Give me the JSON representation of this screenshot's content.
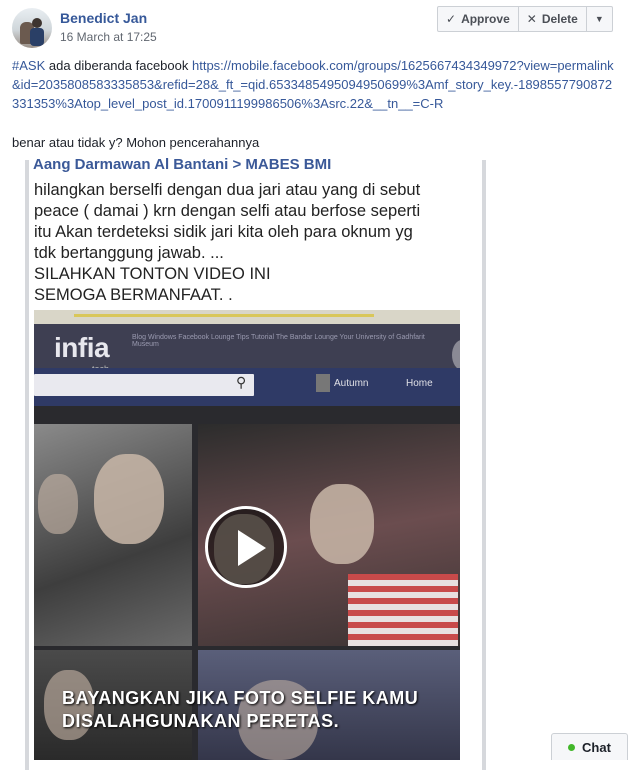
{
  "post": {
    "author": "Benedict Jan",
    "time": "16 March at 17:25",
    "hashtag": "#ASK",
    "text_before_link": " ada diberanda facebook ",
    "link": "https://mobile.facebook.com/groups/1625667434349972?view=permalink&id=2035808583335853&refid=28&_ft_=qid.6533485495094950699%3Amf_story_key.-1898557790872331353%3Atop_level_post_id.1700911199986506%3Asrc.22&__tn__=C-R",
    "question": "benar atau tidak y? Mohon pencerahannya"
  },
  "actions": {
    "approve_label": "Approve",
    "delete_label": "Delete",
    "approve_icon": "check-icon",
    "delete_icon": "close-icon",
    "more_icon": "caret-down-icon"
  },
  "shared": {
    "header": "Aang Darmawan Al Bantani > MABES BMI",
    "body_lines": [
      "hilangkan berselfi dengan dua jari atau yang di sebut",
      "peace ( damai ) krn dengan selfi atau berfose seperti",
      "itu Akan terdeteksi sidik jari kita oleh para oknum yg",
      "tdk bertanggung jawab. ...",
      "SILAHKAN TONTON VIDEO INI",
      "SEMOGA BERMANFAAT. ."
    ]
  },
  "video": {
    "brand": "infia",
    "brand_sub": "tech",
    "menu_text": "Blog   Windows   Facebook   Lounge   Tips   Tutorial   The Bandar Lounge   Your University of Gadhfarit Museum",
    "nav_link_1": "Autumn",
    "nav_link_2": "Home",
    "overlay_line1": "BAYANGKAN JIKA FOTO SELFIE KAMU",
    "overlay_line2": "DISALAHGUNAKAN PERETAS.",
    "play_icon": "play-icon"
  },
  "chat": {
    "label": "Chat",
    "status_color": "#42b72a"
  },
  "colors": {
    "link": "#365899",
    "text": "#1d2129",
    "secondary": "#616770"
  }
}
